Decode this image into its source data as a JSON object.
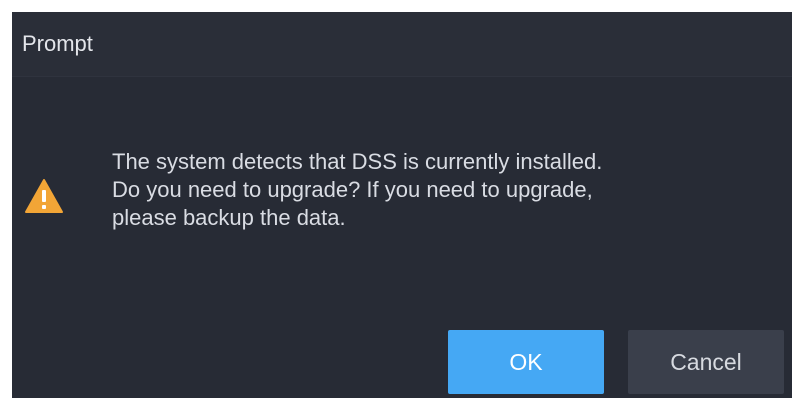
{
  "dialog": {
    "title": "Prompt",
    "icon": "warning-triangle-icon",
    "message_lines": [
      "The system detects that DSS is currently installed.",
      "Do you need to upgrade? If you need to upgrade,",
      "please backup the data."
    ],
    "buttons": {
      "ok_label": "OK",
      "cancel_label": "Cancel"
    },
    "colors": {
      "background": "#272b35",
      "primary_button": "#45a8f4",
      "secondary_button": "#3a3f4b",
      "warning_icon": "#f2a536"
    }
  }
}
